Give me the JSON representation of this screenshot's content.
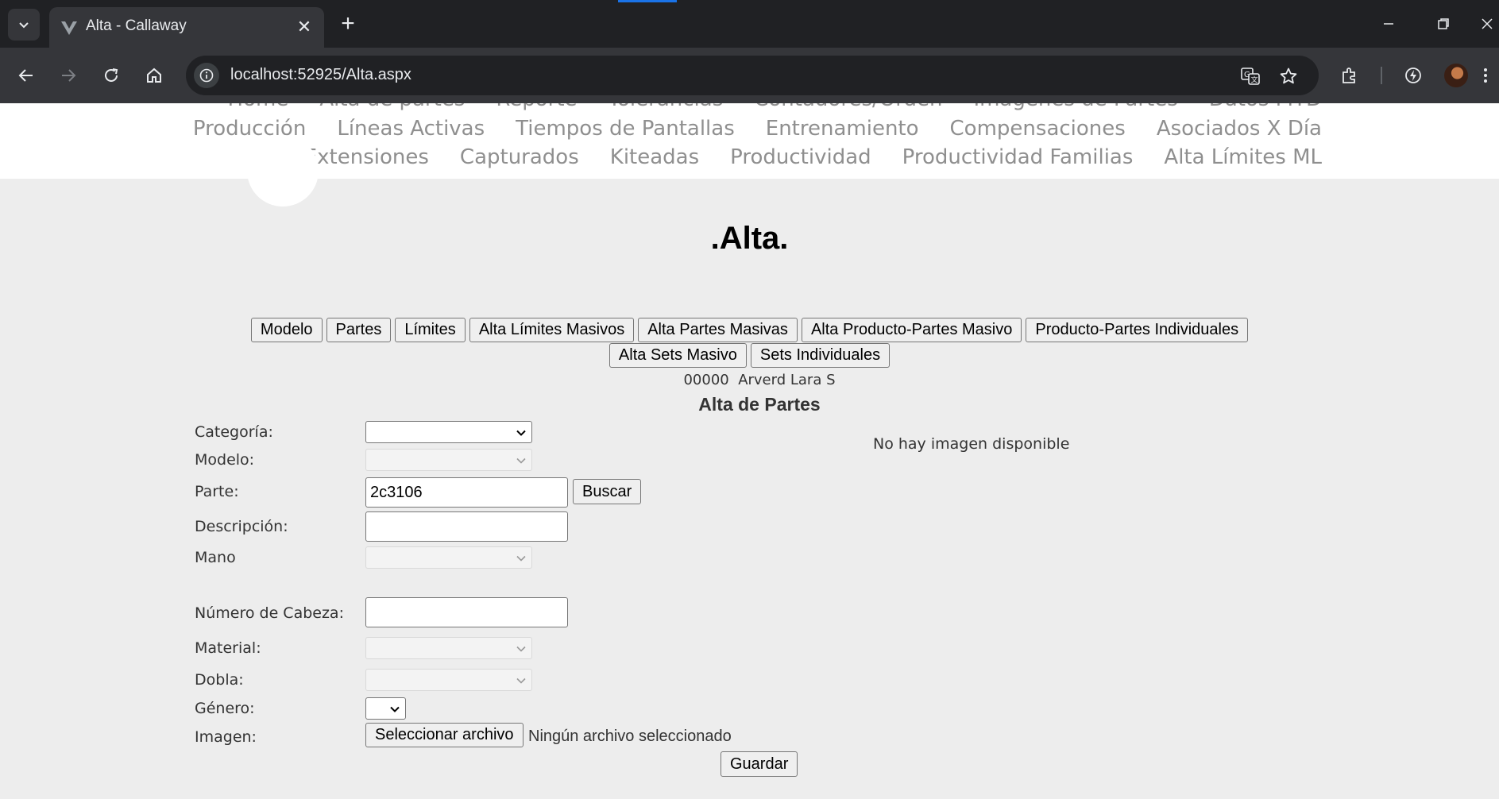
{
  "browser": {
    "tab_title": "Alta - Callaway",
    "url": "localhost:52925/Alta.aspx"
  },
  "nav": {
    "row0": [
      "Home",
      "Alta de partes",
      "Reporte",
      "Tolerancias",
      "Contadores/Orden",
      "Imágenes de Partes",
      "Datos MTD"
    ],
    "row1": [
      "Producción",
      "Líneas Activas",
      "Tiempos de Pantallas",
      "Entrenamiento",
      "Compensaciones",
      "Asociados X Día"
    ],
    "row2": [
      "Extensiones",
      "Capturados",
      "Kiteadas",
      "Productividad",
      "Productividad Familias",
      "Alta Límites ML"
    ]
  },
  "page": {
    "title": ".Alta.",
    "buttons_row1": [
      "Modelo",
      "Partes",
      "Límites",
      "Alta Límites Masivos",
      "Alta Partes Masivas",
      "Alta Producto-Partes Masivo",
      "Producto-Partes Individuales"
    ],
    "buttons_row2": [
      "Alta Sets Masivo",
      "Sets Individuales"
    ],
    "user_line": "00000  Arverd Lara S",
    "section_title": "Alta de Partes"
  },
  "form": {
    "categoria_label": "Categoría:",
    "modelo_label": "Modelo:",
    "parte_label": "Parte:",
    "parte_value": "2c3106",
    "buscar_label": "Buscar",
    "descripcion_label": "Descripción:",
    "descripcion_value": "",
    "mano_label": "Mano",
    "numero_cabeza_label": "Número de Cabeza:",
    "numero_cabeza_value": "",
    "material_label": "Material:",
    "dobla_label": "Dobla:",
    "genero_label": "Género:",
    "imagen_label": "Imagen:",
    "file_button_label": "Seleccionar archivo",
    "file_status": "Ningún archivo seleccionado",
    "guardar_label": "Guardar",
    "no_image_text": "No hay imagen disponible"
  },
  "colors": {
    "accent": "#1a73e8",
    "nav_link": "#8f8f8f",
    "page_bg": "#ededed"
  }
}
